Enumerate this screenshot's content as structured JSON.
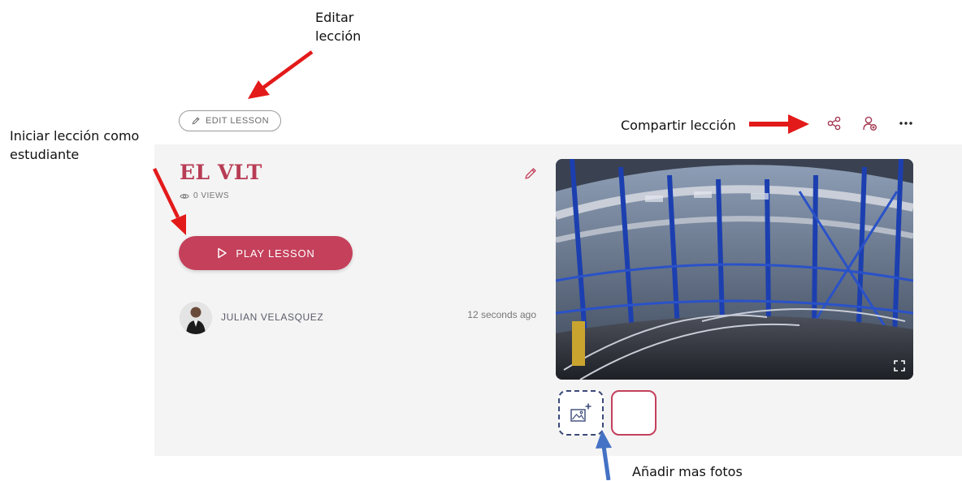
{
  "annotations": {
    "edit_lesson_line1": "Editar",
    "edit_lesson_line2": "lección",
    "play_as_student_line1": "Iniciar lección como",
    "play_as_student_line2": "estudiante",
    "share_lesson": "Compartir lección",
    "add_photos": "Añadir mas fotos"
  },
  "toolbar": {
    "edit_lesson_label": "EDIT LESSON",
    "share_icon": "share-icon",
    "assign_icon": "assign-user-icon",
    "more_icon": "more-horizontal-icon"
  },
  "lesson": {
    "title": "EL VLT",
    "views": "0 VIEWS",
    "play_label": "PLAY LESSON",
    "author": "JULIAN VELASQUEZ",
    "time_ago": "12 seconds ago"
  },
  "colors": {
    "accent": "#c4405b",
    "title": "#b83c55",
    "arrow_red": "#e31a1a",
    "arrow_blue": "#4472c4"
  }
}
